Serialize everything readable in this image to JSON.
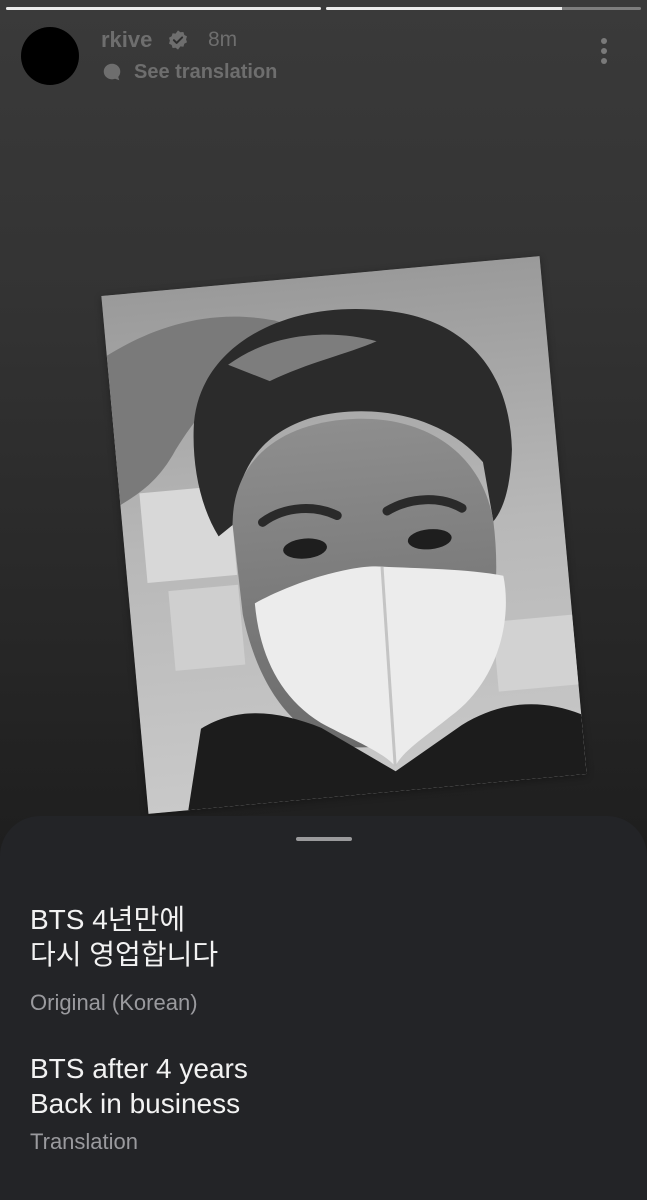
{
  "story": {
    "progress": [
      1,
      0.75
    ],
    "username": "rkive",
    "time": "8m",
    "see_translation": "See translation"
  },
  "sheet": {
    "original_line1": "BTS 4년만에",
    "original_line2": "다시 영업합니다",
    "original_label": "Original (Korean)",
    "translation_line1": "BTS after 4 years",
    "translation_line2": "Back in business",
    "translation_label": "Translation"
  },
  "colors": {
    "sheet_bg": "#232427",
    "header_text": "#6e6e6e",
    "sub_text": "#9a9a9e"
  }
}
